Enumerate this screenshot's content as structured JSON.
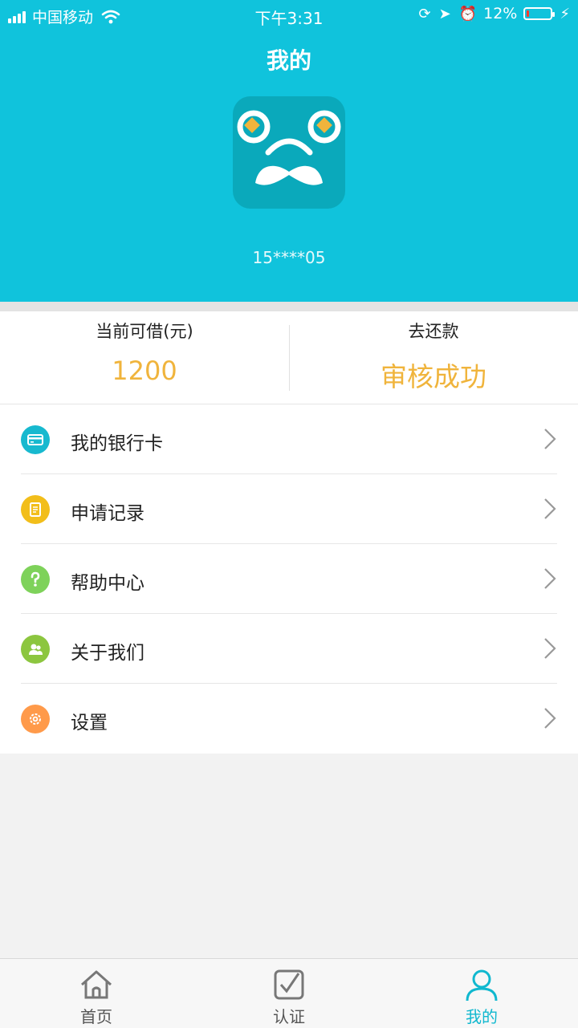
{
  "status_bar": {
    "carrier": "中国移动",
    "time": "下午3:31",
    "battery": "12%",
    "battery_level": 0.12
  },
  "header": {
    "title": "我的",
    "phone": "15****05",
    "colors": {
      "header_bg": "#10c3dc",
      "avatar_bg": "#0aa9bb",
      "accent": "#f0b43c"
    }
  },
  "stats": {
    "available_label": "当前可借(元)",
    "available_value": "1200",
    "repay_label": "去还款",
    "repay_status": "审核成功"
  },
  "menu": {
    "items": [
      {
        "label": "我的银行卡",
        "icon": "bank-card-icon",
        "color": "#17b9cf"
      },
      {
        "label": "申请记录",
        "icon": "document-icon",
        "color": "#f2be1a"
      },
      {
        "label": "帮助中心",
        "icon": "question-icon",
        "color": "#7ed25a"
      },
      {
        "label": "关于我们",
        "icon": "users-icon",
        "color": "#8cc63f"
      },
      {
        "label": "设置",
        "icon": "gear-icon",
        "color": "#ff9a4a"
      }
    ]
  },
  "tabs": [
    {
      "label": "首页",
      "icon": "home-icon",
      "active": false
    },
    {
      "label": "认证",
      "icon": "check-square-icon",
      "active": false
    },
    {
      "label": "我的",
      "icon": "user-icon",
      "active": true
    }
  ]
}
